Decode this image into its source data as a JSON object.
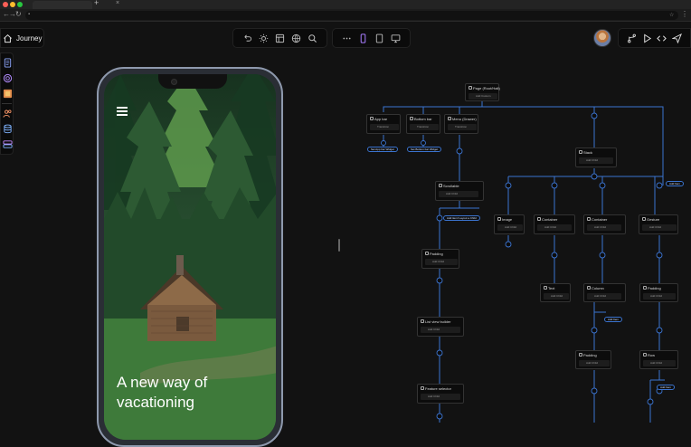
{
  "header": {
    "title": "Journey"
  },
  "colors": {
    "accent": "#3b74d0",
    "background": "#121212",
    "panel": "#0b0b0b",
    "icon_active": "#a87dff"
  },
  "toolbar_left": [
    {
      "name": "undo-icon"
    },
    {
      "name": "sun-icon"
    },
    {
      "name": "layout-icon"
    },
    {
      "name": "globe-icon"
    },
    {
      "name": "search-icon"
    }
  ],
  "toolbar_devices": [
    {
      "name": "more-icon"
    },
    {
      "name": "mobile-icon"
    },
    {
      "name": "tablet-icon"
    },
    {
      "name": "desktop-icon"
    }
  ],
  "toolbar_right": [
    {
      "name": "branch-icon"
    },
    {
      "name": "play-icon"
    },
    {
      "name": "code-icon"
    },
    {
      "name": "send-icon"
    }
  ],
  "sidebar": [
    {
      "name": "pages-icon"
    },
    {
      "name": "components-icon"
    },
    {
      "name": "media-icon"
    },
    {
      "name": "users-icon"
    },
    {
      "name": "database-icon"
    },
    {
      "name": "storage-icon"
    }
  ],
  "preview": {
    "hero_text_line1": "A new way of",
    "hero_text_line2": "vacationing"
  },
  "flow": {
    "nodes": [
      {
        "id": "n-page",
        "title": "Page (Root/Halt)",
        "sub": "Add Custom"
      },
      {
        "id": "n-appbar",
        "title": "App bar",
        "sub": "Transition"
      },
      {
        "id": "n-bottombar",
        "title": "Bottom bar",
        "sub": "Transition"
      },
      {
        "id": "n-menu",
        "title": "Menu (Drawer)",
        "sub": "Transition"
      },
      {
        "id": "n-stack",
        "title": "Stack",
        "sub": "Add Child"
      },
      {
        "id": "n-scroll",
        "title": "Scrollable",
        "sub": "Add Child"
      },
      {
        "id": "n-image",
        "title": "Image",
        "sub": "Add Child"
      },
      {
        "id": "n-container",
        "title": "Container",
        "sub": "Add Child"
      },
      {
        "id": "n-container2",
        "title": "Container",
        "sub": "Add Child"
      },
      {
        "id": "n-gesture",
        "title": "Gesture",
        "sub": "Add Child"
      },
      {
        "id": "n-padding1",
        "title": "Padding",
        "sub": "Add Child"
      },
      {
        "id": "n-text",
        "title": "Text",
        "sub": "Add Child"
      },
      {
        "id": "n-column",
        "title": "Column",
        "sub": "Add Child"
      },
      {
        "id": "n-padding2",
        "title": "Padding",
        "sub": "Add Child"
      },
      {
        "id": "n-listview",
        "title": "List view builder",
        "sub": "Add Child"
      },
      {
        "id": "n-padding3",
        "title": "Padding",
        "sub": "Add Child"
      },
      {
        "id": "n-row",
        "title": "Row",
        "sub": "Add Child"
      },
      {
        "id": "n-feature",
        "title": "Feature selector",
        "sub": "Add Child"
      }
    ],
    "pills": [
      {
        "id": "p-appbar",
        "label": "Set App bar Widget"
      },
      {
        "id": "p-bottom",
        "label": "Set Bottom bar Widget"
      },
      {
        "id": "p-stack",
        "label": "Add Item"
      },
      {
        "id": "p-scroll",
        "label": "Add item/ Layout a Child"
      },
      {
        "id": "p-column",
        "label": "Add Item"
      },
      {
        "id": "p-row",
        "label": "Add Item"
      }
    ]
  }
}
